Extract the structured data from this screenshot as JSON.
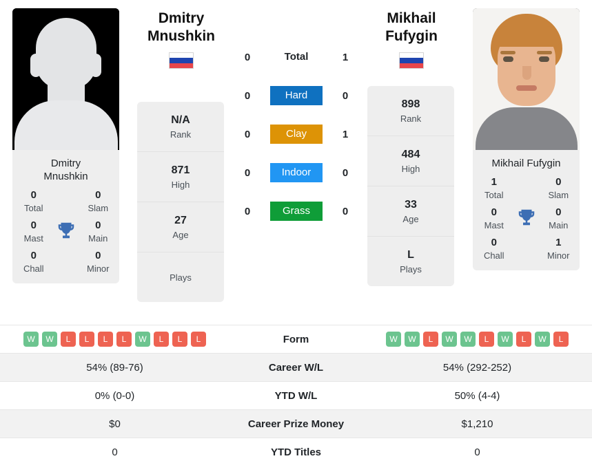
{
  "players": {
    "left": {
      "name": "Dmitry Mnushkin",
      "name_line1": "Dmitry",
      "name_line2": "Mnushkin",
      "photo_type": "placeholder-silhouette",
      "flag": "russia",
      "titles": {
        "total_value": "0",
        "total_label": "Total",
        "slam_value": "0",
        "slam_label": "Slam",
        "mast_value": "0",
        "mast_label": "Mast",
        "main_value": "0",
        "main_label": "Main",
        "chall_value": "0",
        "chall_label": "Chall",
        "minor_value": "0",
        "minor_label": "Minor"
      },
      "stats": [
        {
          "value": "N/A",
          "label": "Rank"
        },
        {
          "value": "871",
          "label": "High"
        },
        {
          "value": "27",
          "label": "Age"
        },
        {
          "value": "",
          "label": "Plays"
        }
      ],
      "form": [
        "W",
        "W",
        "L",
        "L",
        "L",
        "L",
        "W",
        "L",
        "L",
        "L"
      ],
      "career_wl": "54% (89-76)",
      "ytd_wl": "0% (0-0)",
      "career_prize_money": "$0",
      "ytd_titles": "0"
    },
    "right": {
      "name": "Mikhail Fufygin",
      "name_line1": "Mikhail Fufygin",
      "name_line2": "",
      "photo_type": "portrait",
      "flag": "russia",
      "titles": {
        "total_value": "1",
        "total_label": "Total",
        "slam_value": "0",
        "slam_label": "Slam",
        "mast_value": "0",
        "mast_label": "Mast",
        "main_value": "0",
        "main_label": "Main",
        "chall_value": "0",
        "chall_label": "Chall",
        "minor_value": "1",
        "minor_label": "Minor"
      },
      "stats": [
        {
          "value": "898",
          "label": "Rank"
        },
        {
          "value": "484",
          "label": "High"
        },
        {
          "value": "33",
          "label": "Age"
        },
        {
          "value": "L",
          "label": "Plays"
        }
      ],
      "form": [
        "W",
        "W",
        "L",
        "W",
        "W",
        "L",
        "W",
        "L",
        "W",
        "L"
      ],
      "career_wl": "54% (292-252)",
      "ytd_wl": "50% (4-4)",
      "career_prize_money": "$1,210",
      "ytd_titles": "0"
    }
  },
  "head_to_head": [
    {
      "label": "Total",
      "left": "0",
      "right": "1",
      "badge": false,
      "color": ""
    },
    {
      "label": "Hard",
      "left": "0",
      "right": "0",
      "badge": true,
      "color": "#0f71c0"
    },
    {
      "label": "Clay",
      "left": "0",
      "right": "1",
      "badge": true,
      "color": "#dd9306"
    },
    {
      "label": "Indoor",
      "left": "0",
      "right": "0",
      "badge": true,
      "color": "#2196f3"
    },
    {
      "label": "Grass",
      "left": "0",
      "right": "0",
      "badge": true,
      "color": "#0f9d38"
    }
  ],
  "comparison_rows": [
    {
      "label": "Form",
      "left": "",
      "right": ""
    },
    {
      "label": "Career W/L",
      "left": "54% (89-76)",
      "right": "54% (292-252)"
    },
    {
      "label": "YTD W/L",
      "left": "0% (0-0)",
      "right": "50% (4-4)"
    },
    {
      "label": "Career Prize Money",
      "left": "$0",
      "right": "$1,210"
    },
    {
      "label": "YTD Titles",
      "left": "0",
      "right": "0"
    }
  ],
  "icons": {
    "trophy": "trophy-icon"
  },
  "colors": {
    "hard": "#0f71c0",
    "clay": "#dd9306",
    "indoor": "#2196f3",
    "grass": "#0f9d38",
    "win": "#6cc48f",
    "loss": "#ee6352",
    "trophy": "#3d6eb4"
  }
}
